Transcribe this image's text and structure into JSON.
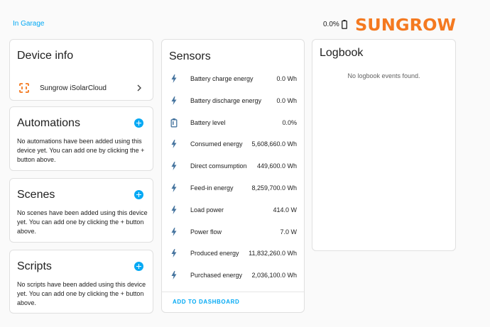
{
  "header": {
    "area_link": "In Garage",
    "battery_level": "0.0%",
    "brand_logo_text": "SUNGROW",
    "brand_color": "#f47920"
  },
  "device_info": {
    "title": "Device info",
    "integration": "Sungrow iSolarCloud"
  },
  "automations": {
    "title": "Automations",
    "empty_text": "No automations have been added using this device yet. You can add one by clicking the + button above."
  },
  "scenes": {
    "title": "Scenes",
    "empty_text": "No scenes have been added using this device yet. You can add one by clicking the + button above."
  },
  "scripts": {
    "title": "Scripts",
    "empty_text": "No scripts have been added using this device yet. You can add one by clicking the + button above."
  },
  "sensors": {
    "title": "Sensors",
    "items": [
      {
        "name": "Battery charge energy",
        "value": "0.0 Wh",
        "icon": "flash-icon"
      },
      {
        "name": "Battery discharge energy",
        "value": "0.0 Wh",
        "icon": "flash-icon"
      },
      {
        "name": "Battery level",
        "value": "0.0%",
        "icon": "battery-icon"
      },
      {
        "name": "Consumed energy",
        "value": "5,608,660.0 Wh",
        "icon": "flash-icon"
      },
      {
        "name": "Direct comsumption",
        "value": "449,600.0 Wh",
        "icon": "flash-icon"
      },
      {
        "name": "Feed-in energy",
        "value": "8,259,700.0 Wh",
        "icon": "flash-icon"
      },
      {
        "name": "Load power",
        "value": "414.0 W",
        "icon": "flash-icon"
      },
      {
        "name": "Power flow",
        "value": "7.0 W",
        "icon": "flash-icon"
      },
      {
        "name": "Produced energy",
        "value": "11,832,260.0 Wh",
        "icon": "flash-icon"
      },
      {
        "name": "Purchased energy",
        "value": "2,036,100.0 Wh",
        "icon": "flash-icon"
      }
    ],
    "add_to_dashboard": "ADD TO DASHBOARD"
  },
  "logbook": {
    "title": "Logbook",
    "empty_text": "No logbook events found."
  },
  "colors": {
    "accent": "#03a9f4",
    "icon": "#44739e",
    "card_border": "#e0e0e0",
    "background": "#fafafa"
  }
}
